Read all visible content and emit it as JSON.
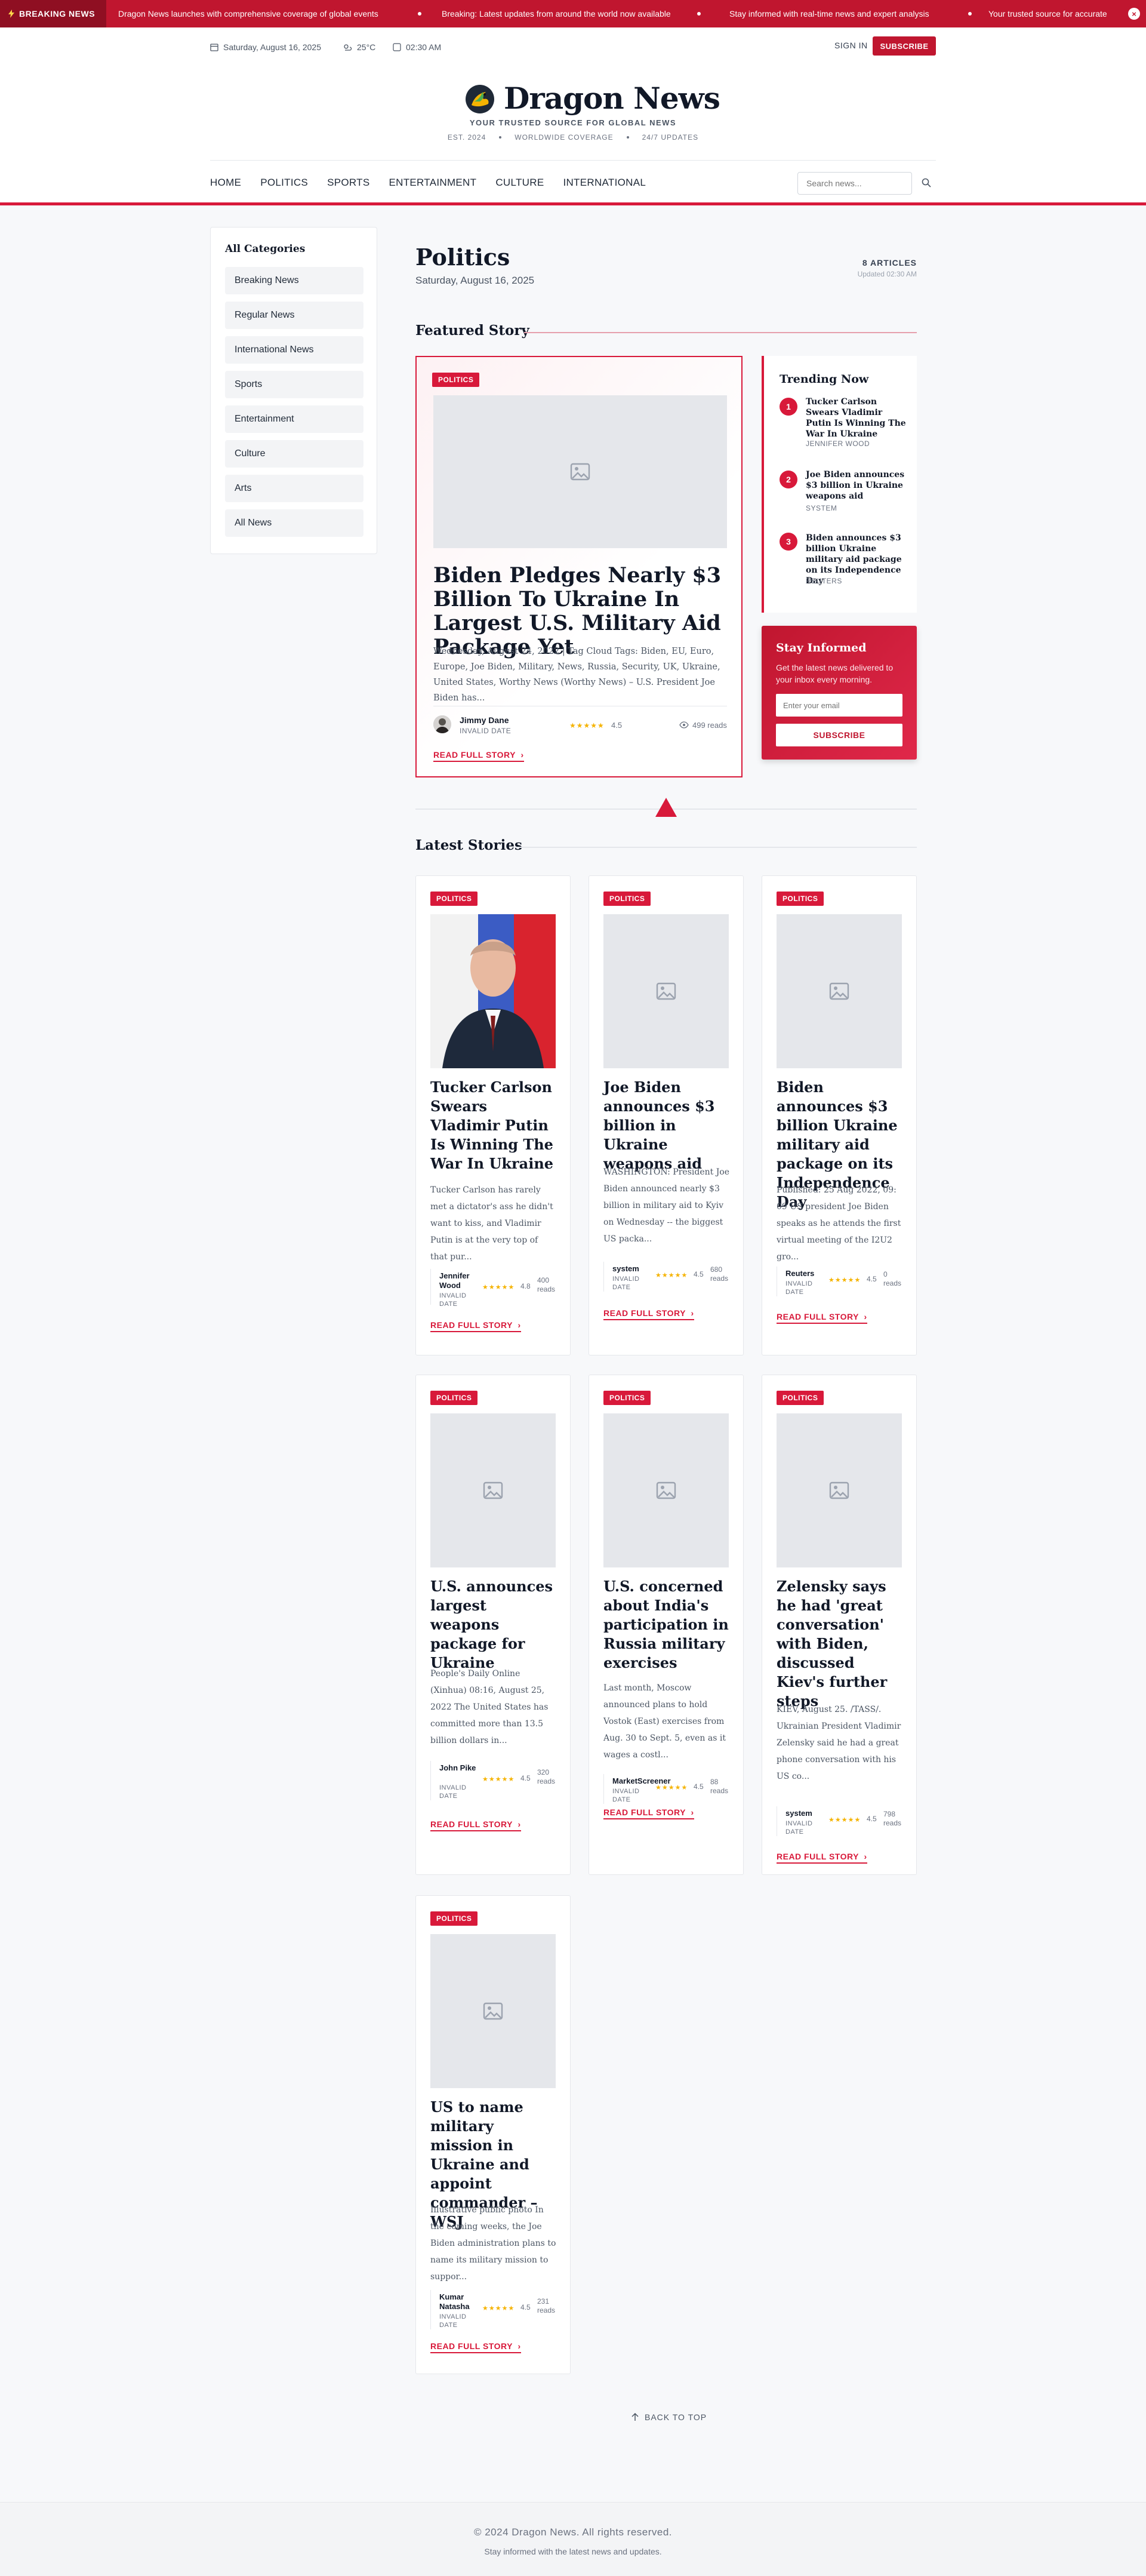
{
  "breaking": {
    "label": "BREAKING NEWS",
    "items": [
      "Dragon News launches with comprehensive coverage of global events",
      "Breaking: Latest updates from around the world now available",
      "Stay informed with real-time news and expert analysis",
      "Your trusted source for accurate"
    ],
    "close_icon": "close-icon"
  },
  "topbar": {
    "date": "Saturday, August 16, 2025",
    "weather": "25°C",
    "time": "02:30 AM",
    "sign_in": "SIGN IN",
    "subscribe": "SUBSCRIBE"
  },
  "brand": {
    "name": "Dragon News",
    "tagline": "YOUR TRUSTED SOURCE FOR GLOBAL NEWS",
    "est": "EST. 2024",
    "coverage": "WORLDWIDE COVERAGE",
    "updates": "24/7 UPDATES"
  },
  "nav": {
    "items": [
      "HOME",
      "POLITICS",
      "SPORTS",
      "ENTERTAINMENT",
      "CULTURE",
      "INTERNATIONAL"
    ],
    "search_placeholder": "Search news..."
  },
  "sidebar": {
    "title": "All Categories",
    "items": [
      "Breaking News",
      "Regular News",
      "International News",
      "Sports",
      "Entertainment",
      "Culture",
      "Arts",
      "All News"
    ]
  },
  "page": {
    "title": "Politics",
    "date": "Saturday, August 16, 2025",
    "article_count": "8 ARTICLES",
    "updated": "Updated 02:30 AM"
  },
  "featured": {
    "section_title": "Featured Story",
    "badge": "POLITICS",
    "title": "Biden Pledges Nearly $3 Billion To Ukraine In Largest U.S. Military Aid Package Yet",
    "excerpt": "Wednesday, August 24, 2022 | Tag Cloud Tags: Biden, EU, Euro, Europe, Joe Biden, Military, News, Russia, Security, UK, Ukraine, United States, Worthy News (Worthy News) – U.S. President Joe Biden has...",
    "author": "Jimmy Dane",
    "date": "INVALID DATE",
    "rating": "4.5",
    "rating_value": 4.5,
    "reads": "499 reads",
    "read_more": "READ FULL STORY"
  },
  "trending": {
    "title": "Trending Now",
    "items": [
      {
        "num": "1",
        "title": "Tucker Carlson Swears Vladimir Putin Is Winning The War In Ukraine",
        "by": "JENNIFER WOOD"
      },
      {
        "num": "2",
        "title": "Joe Biden announces $3 billion in Ukraine weapons aid",
        "by": "SYSTEM"
      },
      {
        "num": "3",
        "title": "Biden announces $3 billion Ukraine military aid package on its Independence Day",
        "by": "REUTERS"
      }
    ]
  },
  "newsletter": {
    "title": "Stay Informed",
    "text": "Get the latest news delivered to your inbox every morning.",
    "placeholder": "Enter your email",
    "button": "SUBSCRIBE"
  },
  "latest": {
    "section_title": "Latest Stories",
    "cards": [
      {
        "badge": "POLITICS",
        "title": "Tucker Carlson Swears Vladimir Putin Is Winning The War In Ukraine",
        "excerpt": "Tucker Carlson has rarely met a dictator's ass he didn't want to kiss, and Vladimir Putin is at the very top of that pur...",
        "author": "Jennifer Wood",
        "date": "INVALID DATE",
        "rating": "4.8",
        "rating_value": 4.8,
        "reads": "400 reads",
        "read_more": "READ FULL STORY",
        "photo": true
      },
      {
        "badge": "POLITICS",
        "title": "Joe Biden announces $3 billion in Ukraine weapons aid",
        "excerpt": "WASHINGTON: President Joe Biden announced nearly $3 billion in military aid to Kyiv on Wednesday -- the biggest US packa...",
        "author": "system",
        "date": "INVALID DATE",
        "rating": "4.5",
        "rating_value": 4.5,
        "reads": "680 reads",
        "read_more": "READ FULL STORY",
        "photo": false
      },
      {
        "badge": "POLITICS",
        "title": "Biden announces $3 billion Ukraine military aid package on its Independence Day",
        "excerpt": "Published: 25 Aug 2022, 09: 09 US president Joe Biden speaks as he attends the first virtual meeting of the I2U2 gro...",
        "author": "Reuters",
        "date": "INVALID DATE",
        "rating": "4.5",
        "rating_value": 4.5,
        "reads": "0 reads",
        "read_more": "READ FULL STORY",
        "photo": false
      },
      {
        "badge": "POLITICS",
        "title": "U.S. announces largest weapons package for Ukraine",
        "excerpt": "People's Daily Online (Xinhua) 08:16, August 25, 2022 The United States has committed more than 13.5 billion dollars in...",
        "author": "John Pike",
        "date": "INVALID DATE",
        "rating": "4.5",
        "rating_value": 4.5,
        "reads": "320 reads",
        "read_more": "READ FULL STORY",
        "photo": false
      },
      {
        "badge": "POLITICS",
        "title": "U.S. concerned about India's participation in Russia military exercises",
        "excerpt": "Last month, Moscow announced plans to hold Vostok (East) exercises from Aug. 30 to Sept. 5, even as it wages a costl...",
        "author": "MarketScreener",
        "date": "INVALID DATE",
        "rating": "4.5",
        "rating_value": 4.5,
        "reads": "88 reads",
        "read_more": "READ FULL STORY",
        "photo": false
      },
      {
        "badge": "POLITICS",
        "title": "Zelensky says he had 'great conversation' with Biden, discussed Kiev's further steps",
        "excerpt": "KIEV, August 25. /TASS/. Ukrainian President Vladimir Zelensky said he had a great phone conversation with his US co...",
        "author": "system",
        "date": "INVALID DATE",
        "rating": "4.5",
        "rating_value": 4.5,
        "reads": "798 reads",
        "read_more": "READ FULL STORY",
        "photo": false
      },
      {
        "badge": "POLITICS",
        "title": "US to name military mission in Ukraine and appoint commander – WSJ",
        "excerpt": "Illustrative public photo In the coming weeks, the Joe Biden administration plans to name its military mission to suppor...",
        "author": "Kumar Natasha",
        "date": "INVALID DATE",
        "rating": "4.5",
        "rating_value": 4.5,
        "reads": "231 reads",
        "read_more": "READ FULL STORY",
        "photo": false
      }
    ]
  },
  "back_to_top": "BACK TO TOP",
  "footer": {
    "copyright": "© 2024 Dragon News. All rights reserved.",
    "sub": "Stay informed with the latest news and updates."
  },
  "colors": {
    "accent": "#d8193a",
    "breaking_bg": "#c0162f",
    "star": "#f5b301"
  }
}
